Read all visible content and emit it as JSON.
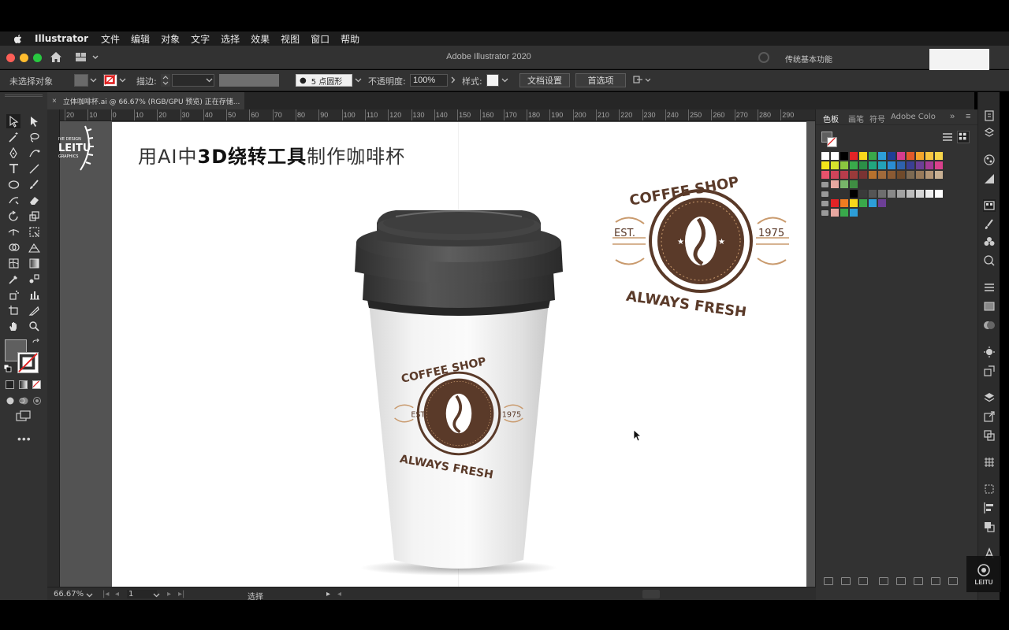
{
  "menubar": {
    "app": "Illustrator",
    "items": [
      "文件",
      "编辑",
      "对象",
      "文字",
      "选择",
      "效果",
      "视图",
      "窗口",
      "帮助"
    ]
  },
  "window": {
    "title": "Adobe Illustrator 2020",
    "workspace": "传统基本功能"
  },
  "control": {
    "no_selection": "未选择对象",
    "stroke_label": "描边:",
    "brush_label": "5 点圆形",
    "opacity_label": "不透明度:",
    "opacity_value": "100%",
    "style_label": "样式:",
    "doc_setup": "文档设置",
    "preferences": "首选项"
  },
  "doc_tab": {
    "close": "×",
    "name": "立体咖啡杯.ai @ 66.67% (RGB/GPU 预览) 正在存储..."
  },
  "ruler": {
    "labels": [
      "20",
      "10",
      "0",
      "10",
      "20",
      "30",
      "40",
      "50",
      "60",
      "70",
      "80",
      "90",
      "100",
      "110",
      "120",
      "130",
      "140",
      "150",
      "160",
      "170",
      "180",
      "190",
      "200",
      "210",
      "220",
      "230",
      "240",
      "250",
      "260",
      "270",
      "280",
      "290"
    ]
  },
  "artboard": {
    "headline_prefix": "用AI中",
    "headline_bold": "3D绕转工具",
    "headline_suffix": "制作咖啡杯"
  },
  "logo": {
    "top_text": "COFFEE SHOP",
    "bottom_text": "ALWAYS FRESH",
    "est": "EST.",
    "year": "1975"
  },
  "badge": {
    "top": "IVE DESIGN",
    "middle": "LEITU",
    "bottom": "GRAPHICS"
  },
  "panel": {
    "tabs": [
      "色板",
      "画笔",
      "符号",
      "Adobe Colo"
    ],
    "swatch_rows": [
      [
        "#ffffff",
        "#ffffff",
        "#000000",
        "#e32326",
        "#f9d71c",
        "#3aa84a",
        "#2d9ed8",
        "#1f3f95",
        "#d63c8e",
        "#e25a2a",
        "#f4a52b",
        "#f8c541",
        "#f7d54a"
      ],
      [
        "#f3e61a",
        "#d6e22c",
        "#8bc53f",
        "#39a94b",
        "#2b8f47",
        "#21a77f",
        "#23a3b8",
        "#2a8ed3",
        "#2e62ad",
        "#3b3f93",
        "#6d3f96",
        "#a43a95",
        "#d9408c"
      ],
      [
        "#e8526c",
        "#d0445a",
        "#b83c4b",
        "#9a3a3a",
        "#7a3333",
        "#b7712d",
        "#a06a3b",
        "#8a5a33",
        "#6f4a2b",
        "#7d6a52",
        "#987a5a",
        "#b49676",
        "#c8b093"
      ],
      [
        "#e8a7a0",
        "#78b56a",
        "#3f8e43"
      ],
      [
        "#000000",
        "#3a3a3a",
        "#555555",
        "#6e6e6e",
        "#888888",
        "#a2a2a2",
        "#bcbcbc",
        "#d6d6d6",
        "#efefef",
        "#ffffff"
      ],
      [
        "#e32326",
        "#f07c21",
        "#f9d71c",
        "#3aa84a",
        "#2d9ed8",
        "#6d3f96"
      ],
      [
        "#e8a7a0",
        "#39a94b",
        "#2d9ed8"
      ]
    ]
  },
  "status": {
    "zoom": "66.67%",
    "page": "1",
    "tool": "选择"
  },
  "watermark": {
    "text": "LEITU"
  },
  "colors": {
    "brand_brown": "#5a3a29",
    "accent_tan": "#c99a6d",
    "lid_dark": "#3a3a3a",
    "cup_white": "#f2f2f2"
  }
}
